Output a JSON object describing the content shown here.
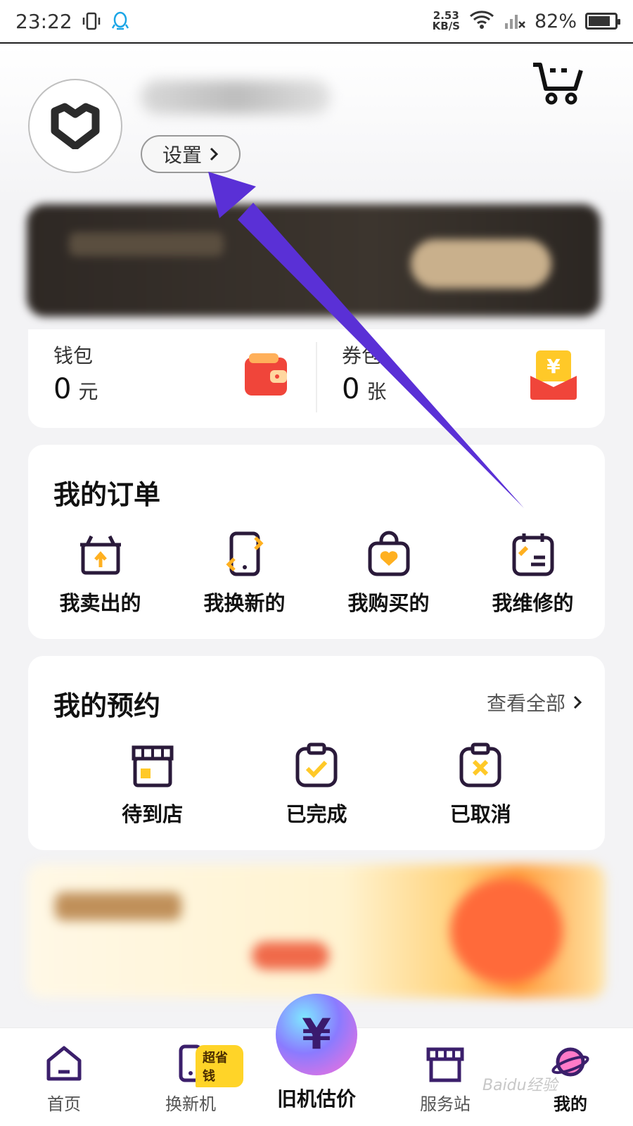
{
  "status_bar": {
    "time": "23:22",
    "speed_value": "2.53",
    "speed_unit": "KB/S",
    "battery": "82%",
    "battery_level": 0.82
  },
  "profile": {
    "settings_label": "设置",
    "icons": [
      "app-logo-icon",
      "cart-icon",
      "chevron-right-icon"
    ]
  },
  "wallet": {
    "label": "钱包",
    "value": "0",
    "unit": "元"
  },
  "coupon": {
    "label": "券包",
    "value": "0",
    "unit": "张"
  },
  "orders": {
    "title": "我的订单",
    "items": [
      {
        "label": "我卖出的",
        "icon": "sold-box-icon"
      },
      {
        "label": "我换新的",
        "icon": "phone-exchange-icon"
      },
      {
        "label": "我购买的",
        "icon": "shopping-bag-icon"
      },
      {
        "label": "我维修的",
        "icon": "repair-icon"
      }
    ]
  },
  "reservations": {
    "title": "我的预约",
    "view_all": "查看全部",
    "items": [
      {
        "label": "待到店",
        "icon": "store-icon"
      },
      {
        "label": "已完成",
        "icon": "clipboard-check-icon"
      },
      {
        "label": "已取消",
        "icon": "clipboard-cancel-icon"
      }
    ]
  },
  "bottom_nav": {
    "home": "首页",
    "exchange": "换新机",
    "exchange_badge": "超省钱",
    "center_symbol": "¥",
    "center": "旧机估价",
    "station": "服务站",
    "mine": "我的"
  },
  "watermark": "Baidu经验",
  "colors": {
    "accent_purple": "#4b2a8a",
    "accent_yellow": "#ffc928",
    "arrow": "#5a30d6"
  }
}
